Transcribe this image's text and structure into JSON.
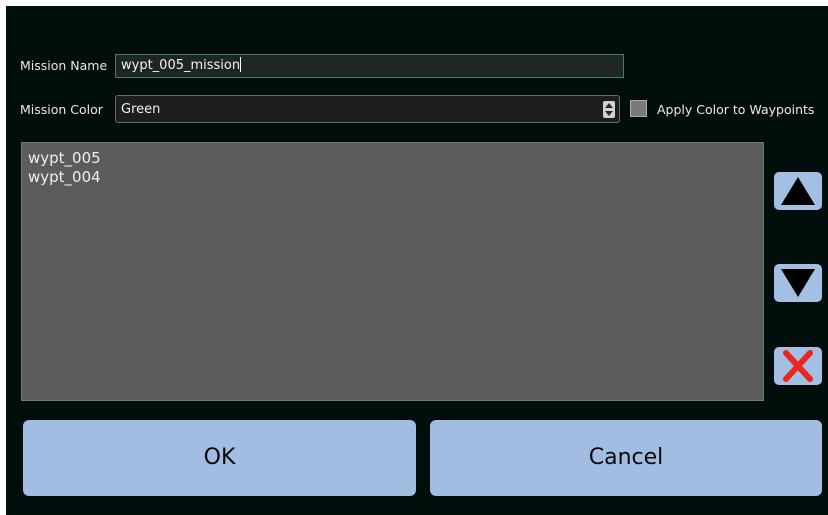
{
  "mission_name": {
    "label": "Mission Name",
    "value": "wypt_005_mission"
  },
  "mission_color": {
    "label": "Mission Color",
    "selected": "Green",
    "apply_checkbox_label": "Apply Color to Waypoints",
    "apply_checked": false
  },
  "waypoints": {
    "items": [
      "wypt_005",
      "wypt_004"
    ]
  },
  "side_buttons": {
    "move_up_icon": "triangle-up-icon",
    "move_down_icon": "triangle-down-icon",
    "delete_icon": "red-x-icon"
  },
  "buttons": {
    "ok_label": "OK",
    "cancel_label": "Cancel"
  },
  "colors": {
    "background": "#020e0b",
    "button": "#a2bce2",
    "list_bg": "#5c5c5c",
    "delete_red": "#e8271f"
  }
}
